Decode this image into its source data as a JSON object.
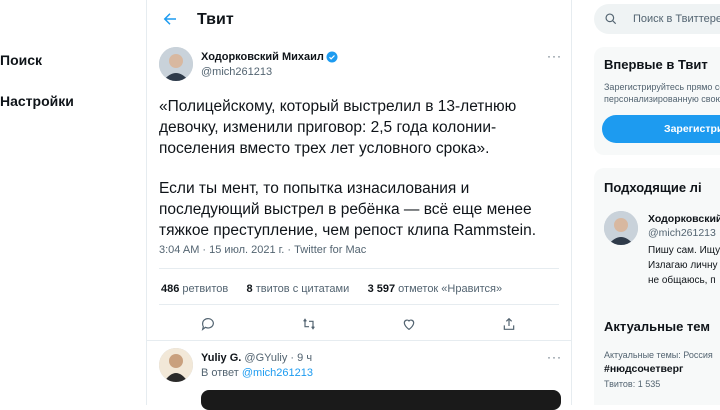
{
  "nav": {
    "search": "Поиск",
    "settings": "Настройки"
  },
  "header": {
    "title": "Твит"
  },
  "tweet": {
    "author_name": "Ходорковский Михаил",
    "author_handle": "@mich261213",
    "paragraph1": "«Полицейскому, который выстрелил в 13-летнюю девочку, изменили приговор: 2,5 года колонии-поселения вместо трех лет условного срока».",
    "paragraph2": "Если ты мент, то попытка изнасилования и последующий выстрел в ребёнка — всё еще менее тяжкое преступление, чем репост клипа Rammstein.",
    "meta": "3:04 AM · 15 июл. 2021 г. · Twitter for Mac",
    "retweets_count": "486",
    "retweets_label": "ретвитов",
    "quotes_count": "8",
    "quotes_label": "твитов с цитатами",
    "likes_count": "3 597",
    "likes_label": "отметок «Нравится»"
  },
  "reply": {
    "name": "Yuliy G.",
    "handle": "@GYuliy · 9 ч",
    "in_reply_prefix": "В ответ",
    "in_reply_handle": "@mich261213"
  },
  "sidebar": {
    "search_placeholder": "Поиск в Твиттере",
    "signup_card": {
      "title": "Впервые в Твит",
      "line1": "Зарегистрируйтесь прямо се",
      "line2": "персонализированную свою ле",
      "button": "Зарегистри"
    },
    "who_card": {
      "title": "Подходящие лі",
      "name": "Ходорковский",
      "handle": "@mich261213",
      "bio1": "Пишу сам. Ищу",
      "bio2": "Излагаю личну",
      "bio3": "не общаюсь, п"
    },
    "trends_card": {
      "title": "Актуальные тем",
      "context": "Актуальные темы: Россия",
      "tag": "#нюдсочетверг",
      "count": "Твитов: 1 535"
    }
  },
  "colors": {
    "accent": "#1d9bf0",
    "text": "#0f1419",
    "muted": "#536471"
  }
}
